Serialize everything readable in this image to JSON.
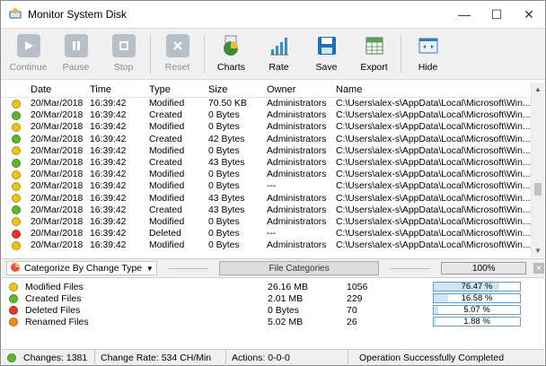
{
  "window": {
    "title": "Monitor System Disk"
  },
  "toolbar": [
    {
      "label": "Continue",
      "enabled": false,
      "icon": "play-icon"
    },
    {
      "label": "Pause",
      "enabled": false,
      "icon": "pause-icon"
    },
    {
      "label": "Stop",
      "enabled": false,
      "icon": "stop-icon"
    },
    {
      "label": "Reset",
      "enabled": false,
      "icon": "reset-x-icon"
    },
    {
      "label": "Charts",
      "enabled": true,
      "icon": "pie-chart-icon"
    },
    {
      "label": "Rate",
      "enabled": true,
      "icon": "bar-rate-icon"
    },
    {
      "label": "Save",
      "enabled": true,
      "icon": "floppy-disk-icon"
    },
    {
      "label": "Export",
      "enabled": true,
      "icon": "spreadsheet-export-icon"
    },
    {
      "label": "Hide",
      "enabled": true,
      "icon": "hide-window-icon"
    }
  ],
  "table": {
    "columns": [
      "Date",
      "Time",
      "Type",
      "Size",
      "Owner",
      "Name"
    ],
    "rows": [
      {
        "status": "yellow",
        "date": "20/Mar/2018",
        "time": "16:39:42",
        "type": "Modified",
        "size": "70.50 KB",
        "owner": "Administrators",
        "name": "C:\\Users\\alex-s\\AppData\\Local\\Microsoft\\Win..."
      },
      {
        "status": "green",
        "date": "20/Mar/2018",
        "time": "16:39:42",
        "type": "Created",
        "size": "0 Bytes",
        "owner": "Administrators",
        "name": "C:\\Users\\alex-s\\AppData\\Local\\Microsoft\\Win..."
      },
      {
        "status": "yellow",
        "date": "20/Mar/2018",
        "time": "16:39:42",
        "type": "Modified",
        "size": "0 Bytes",
        "owner": "Administrators",
        "name": "C:\\Users\\alex-s\\AppData\\Local\\Microsoft\\Win..."
      },
      {
        "status": "green",
        "date": "20/Mar/2018",
        "time": "16:39:42",
        "type": "Created",
        "size": "42 Bytes",
        "owner": "Administrators",
        "name": "C:\\Users\\alex-s\\AppData\\Local\\Microsoft\\Win..."
      },
      {
        "status": "yellow",
        "date": "20/Mar/2018",
        "time": "16:39:42",
        "type": "Modified",
        "size": "0 Bytes",
        "owner": "Administrators",
        "name": "C:\\Users\\alex-s\\AppData\\Local\\Microsoft\\Win..."
      },
      {
        "status": "green",
        "date": "20/Mar/2018",
        "time": "16:39:42",
        "type": "Created",
        "size": "43 Bytes",
        "owner": "Administrators",
        "name": "C:\\Users\\alex-s\\AppData\\Local\\Microsoft\\Win..."
      },
      {
        "status": "yellow",
        "date": "20/Mar/2018",
        "time": "16:39:42",
        "type": "Modified",
        "size": "0 Bytes",
        "owner": "Administrators",
        "name": "C:\\Users\\alex-s\\AppData\\Local\\Microsoft\\Win..."
      },
      {
        "status": "yellow",
        "date": "20/Mar/2018",
        "time": "16:39:42",
        "type": "Modified",
        "size": "0 Bytes",
        "owner": "---",
        "name": "C:\\Users\\alex-s\\AppData\\Local\\Microsoft\\Win..."
      },
      {
        "status": "yellow",
        "date": "20/Mar/2018",
        "time": "16:39:42",
        "type": "Modified",
        "size": "43 Bytes",
        "owner": "Administrators",
        "name": "C:\\Users\\alex-s\\AppData\\Local\\Microsoft\\Win..."
      },
      {
        "status": "green",
        "date": "20/Mar/2018",
        "time": "16:39:42",
        "type": "Created",
        "size": "43 Bytes",
        "owner": "Administrators",
        "name": "C:\\Users\\alex-s\\AppData\\Local\\Microsoft\\Win..."
      },
      {
        "status": "yellow",
        "date": "20/Mar/2018",
        "time": "16:39:42",
        "type": "Modified",
        "size": "0 Bytes",
        "owner": "Administrators",
        "name": "C:\\Users\\alex-s\\AppData\\Local\\Microsoft\\Win..."
      },
      {
        "status": "red",
        "date": "20/Mar/2018",
        "time": "16:39:42",
        "type": "Deleted",
        "size": "0 Bytes",
        "owner": "---",
        "name": "C:\\Users\\alex-s\\AppData\\Local\\Microsoft\\Win..."
      },
      {
        "status": "yellow",
        "date": "20/Mar/2018",
        "time": "16:39:42",
        "type": "Modified",
        "size": "0 Bytes",
        "owner": "Administrators",
        "name": "C:\\Users\\alex-s\\AppData\\Local\\Microsoft\\Win..."
      }
    ]
  },
  "filter": {
    "category_label": "Categorize By Change Type",
    "file_categories_label": "File Categories",
    "percent": "100%"
  },
  "categories": [
    {
      "status": "yellow",
      "name": "Modified Files",
      "size": "26.16 MB",
      "count": "1056",
      "percent_label": "76.47 %",
      "percent_value": 76.47
    },
    {
      "status": "green",
      "name": "Created Files",
      "size": "2.01 MB",
      "count": "229",
      "percent_label": "16.58 %",
      "percent_value": 16.58
    },
    {
      "status": "red",
      "name": "Deleted Files",
      "size": "0 Bytes",
      "count": "70",
      "percent_label": "5.07 %",
      "percent_value": 5.07
    },
    {
      "status": "orange",
      "name": "Renamed Files",
      "size": "5.02 MB",
      "count": "26",
      "percent_label": "1.88 %",
      "percent_value": 1.88
    }
  ],
  "statusbar": {
    "changes": "Changes: 1381",
    "rate": "Change Rate: 534 CH/Min",
    "actions": "Actions: 0-0-0",
    "message": "Operation Successfully Completed"
  },
  "colors": {
    "yellow": "#f1c21b",
    "green": "#5cb82a",
    "red": "#e23a26",
    "orange": "#f08a1a",
    "accent": "#2e7dc5"
  }
}
